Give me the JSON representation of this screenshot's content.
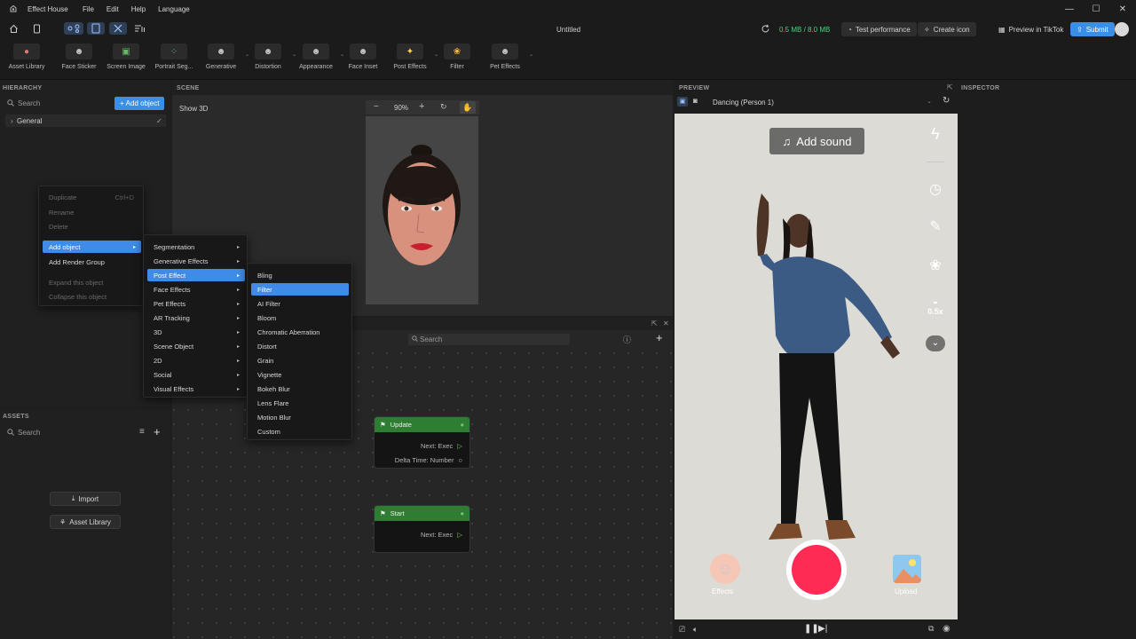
{
  "app": {
    "name": "Effect House",
    "menu": [
      "File",
      "Edit",
      "Help",
      "Language"
    ],
    "doc_title": "Untitled"
  },
  "topbar": {
    "memory": "0.5 MB / 8.0 MB",
    "test_performance": "Test performance",
    "create_icon": "Create icon",
    "preview_tiktok": "Preview in TikTok",
    "submit": "Submit",
    "memory_color": "#4cd07d",
    "accent": "#3a8ee6"
  },
  "assets_strip": [
    {
      "label": "Asset Library",
      "icon": "asset-library-icon"
    },
    {
      "label": "Face Sticker",
      "icon": "face-sticker-icon"
    },
    {
      "label": "Screen Image",
      "icon": "screen-image-icon"
    },
    {
      "label": "Portrait Seg...",
      "icon": "portrait-seg-icon"
    },
    {
      "label": "Generative",
      "icon": "generative-icon"
    },
    {
      "label": "Distortion",
      "icon": "distortion-icon"
    },
    {
      "label": "Appearance",
      "icon": "appearance-icon"
    },
    {
      "label": "Face Inset",
      "icon": "face-inset-icon"
    },
    {
      "label": "Post Effects",
      "icon": "post-effects-icon"
    },
    {
      "label": "Filter",
      "icon": "filter-icon"
    },
    {
      "label": "Pet Effects",
      "icon": "pet-effects-icon"
    }
  ],
  "hierarchy": {
    "title": "HIERARCHY",
    "search_placeholder": "Search",
    "add_object": "Add object",
    "general": "General"
  },
  "assets_panel": {
    "title": "ASSETS",
    "search_placeholder": "Search",
    "import": "Import",
    "asset_library": "Asset Library"
  },
  "scene": {
    "title": "SCENE",
    "show_3d": "Show 3D",
    "zoom": "90%"
  },
  "graph": {
    "search_placeholder": "Search",
    "nodes": [
      {
        "title": "Update",
        "rows": [
          "Next: Exec",
          "Delta Time: Number"
        ]
      },
      {
        "title": "Start",
        "rows": [
          "Next: Exec"
        ]
      }
    ]
  },
  "context_menu": {
    "items": [
      {
        "label": "Duplicate",
        "shortcut": "Ctrl+D",
        "disabled": true
      },
      {
        "label": "Rename",
        "disabled": true
      },
      {
        "label": "Delete",
        "disabled": true
      },
      {
        "label": "Add object",
        "selected": true
      },
      {
        "label": "Add Render Group"
      },
      {
        "label": "Expand this object",
        "disabled": true
      },
      {
        "label": "Collapse this object",
        "disabled": true
      }
    ]
  },
  "submenu_add": [
    "Segmentation",
    "Generative Effects",
    "Post Effect",
    "Face Effects",
    "Pet Effects",
    "AR Tracking",
    "3D",
    "Scene Object",
    "2D",
    "Social",
    "Visual Effects"
  ],
  "submenu_post": [
    "Bling",
    "Filter",
    "AI Filter",
    "Bloom",
    "Chromatic Aberration",
    "Distort",
    "Grain",
    "Vignette",
    "Bokeh Blur",
    "Lens Flare",
    "Motion Blur",
    "Custom"
  ],
  "preview": {
    "title": "PREVIEW",
    "source": "Dancing (Person 1)",
    "add_sound": "Add sound",
    "speed": "0.5x",
    "effects": "Effects",
    "upload": "Upload",
    "record_color": "#fe2c55"
  },
  "inspector": {
    "title": "INSPECTOR"
  }
}
